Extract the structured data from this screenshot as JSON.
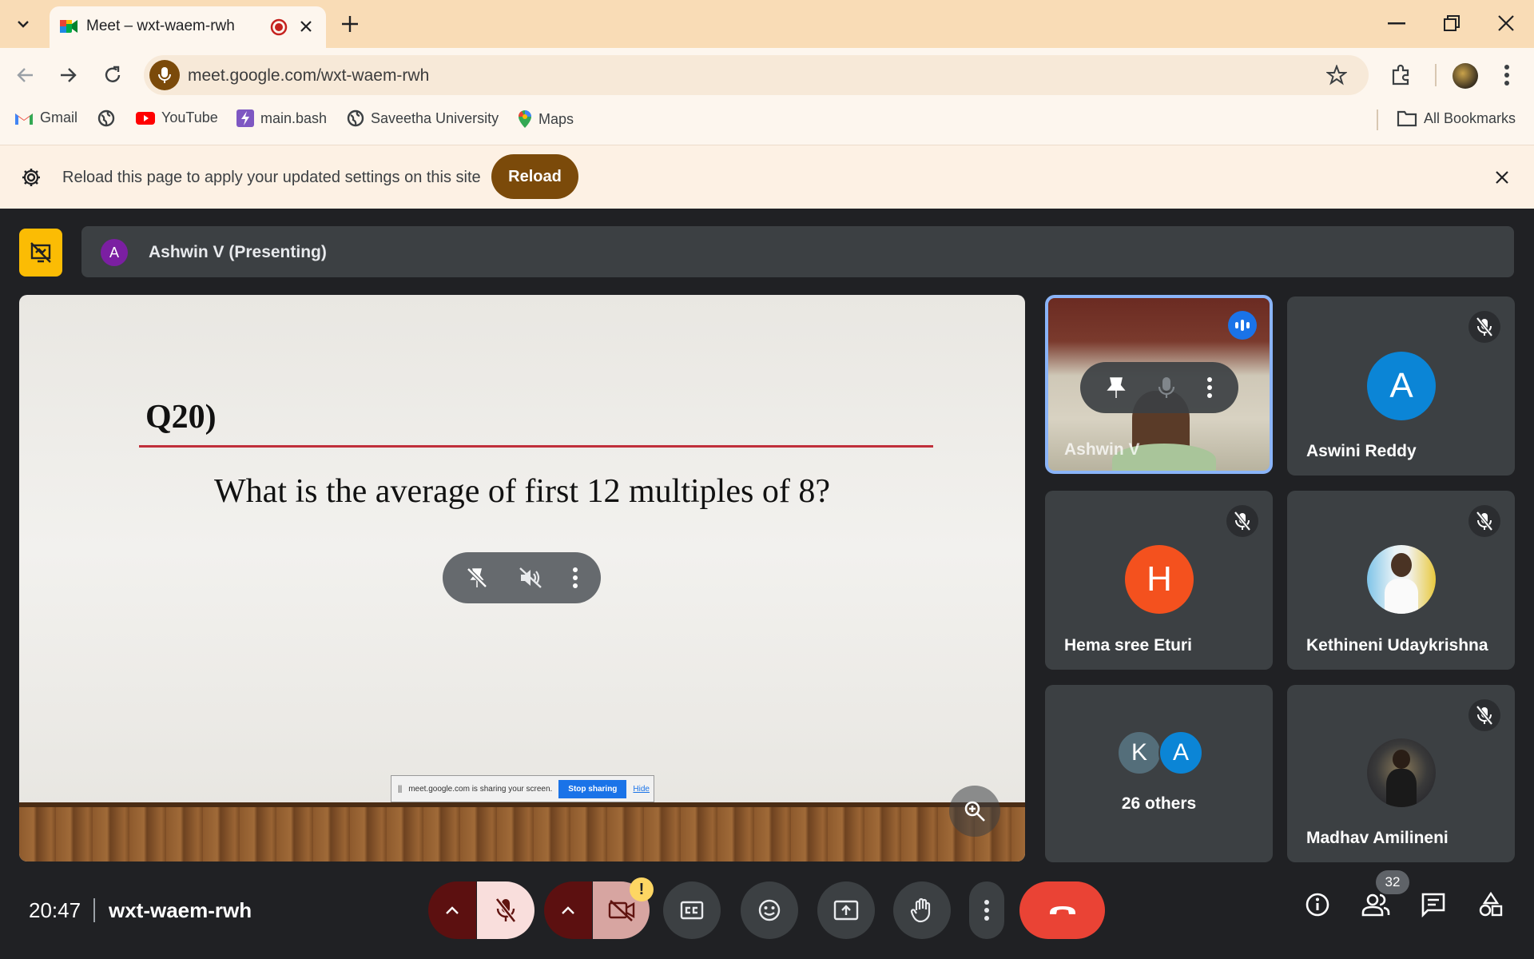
{
  "browser": {
    "tab_title": "Meet – wxt-waem-rwh",
    "url": "meet.google.com/wxt-waem-rwh",
    "bookmarks": [
      {
        "label": "Gmail",
        "icon": "gmail-icon"
      },
      {
        "label": "",
        "icon": "globe-icon"
      },
      {
        "label": "YouTube",
        "icon": "youtube-icon"
      },
      {
        "label": "main.bash",
        "icon": "bash-icon"
      },
      {
        "label": "Saveetha University",
        "icon": "globe-icon"
      },
      {
        "label": "Maps",
        "icon": "maps-icon"
      }
    ],
    "all_bookmarks": "All Bookmarks",
    "infobar_message": "Reload this page to apply your updated settings on this site",
    "reload_label": "Reload"
  },
  "meet": {
    "presenter": {
      "initial": "A",
      "label": "Ashwin V (Presenting)"
    },
    "slide": {
      "title": "Q20)",
      "question": "What is the average of first 12 multiples of 8?"
    },
    "share_notice": {
      "text": "meet.google.com is sharing your screen.",
      "stop": "Stop sharing",
      "hide": "Hide"
    },
    "tiles": [
      {
        "name": "Ashwin V",
        "speaking": true
      },
      {
        "name": "Aswini Reddy",
        "initial": "A",
        "color": "#0b85d6",
        "muted": true
      },
      {
        "name": "Hema sree Eturi",
        "initial": "H",
        "color": "#f4511e",
        "muted": true
      },
      {
        "name": "Kethineni Udaykrishna",
        "muted": true
      },
      {
        "name": "26 others",
        "initials": [
          "K",
          "A"
        ],
        "colors": [
          "#546e7a",
          "#0b85d6"
        ]
      },
      {
        "name": "Madhav Amilineni",
        "muted": true
      }
    ],
    "bottom": {
      "time": "20:47",
      "meeting_code": "wxt-waem-rwh",
      "people_count": "32"
    },
    "colors": {
      "end_call": "#ea4335",
      "mic_off_bg": "#f9dedc",
      "accent": "#8ab4f8"
    }
  }
}
